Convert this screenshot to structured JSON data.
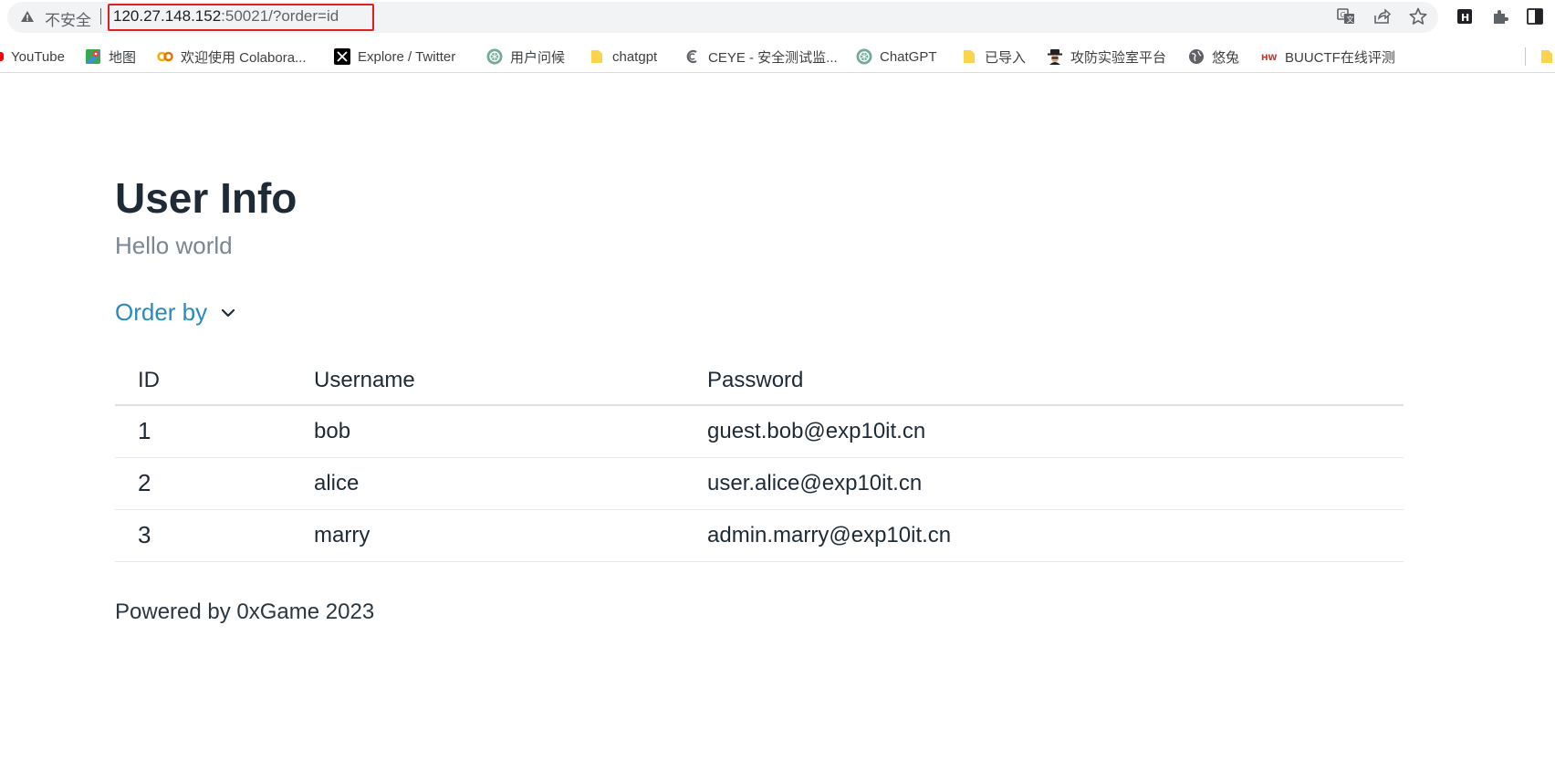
{
  "browser": {
    "security_label": "不安全",
    "url_host": "120.27.148.152",
    "url_rest": ":50021/?order=id"
  },
  "bookmarks": [
    {
      "label": "YouTube",
      "icon": "youtube-icon"
    },
    {
      "label": "地图",
      "icon": "maps-icon"
    },
    {
      "label": "欢迎使用 Colabora...",
      "icon": "colab-icon"
    },
    {
      "label": "Explore / Twitter",
      "icon": "x-twitter-icon"
    },
    {
      "label": "用户问候",
      "icon": "openai-icon"
    },
    {
      "label": "chatgpt",
      "icon": "folder-icon"
    },
    {
      "label": "CEYE - 安全测试监...",
      "icon": "ceye-icon"
    },
    {
      "label": "ChatGPT",
      "icon": "openai-icon"
    },
    {
      "label": "已导入",
      "icon": "folder-icon"
    },
    {
      "label": "攻防实验室平台",
      "icon": "hacker-icon"
    },
    {
      "label": "悠兔",
      "icon": "globe-icon"
    },
    {
      "label": "BUUCTF在线评测",
      "icon": "buuctf-icon"
    }
  ],
  "page": {
    "title": "User Info",
    "subtitle": "Hello world",
    "order_by_label": "Order by",
    "footer": "Powered by 0xGame 2023"
  },
  "table": {
    "headers": [
      "ID",
      "Username",
      "Password"
    ],
    "rows": [
      {
        "id": "1",
        "username": "bob",
        "password": "guest.bob@exp10it.cn"
      },
      {
        "id": "2",
        "username": "alice",
        "password": "user.alice@exp10it.cn"
      },
      {
        "id": "3",
        "username": "marry",
        "password": "admin.marry@exp10it.cn"
      }
    ]
  },
  "colors": {
    "accent": "#2a8ab8",
    "heading": "#1e2a36",
    "muted": "#7a8691",
    "url_highlight": "#e02020"
  }
}
